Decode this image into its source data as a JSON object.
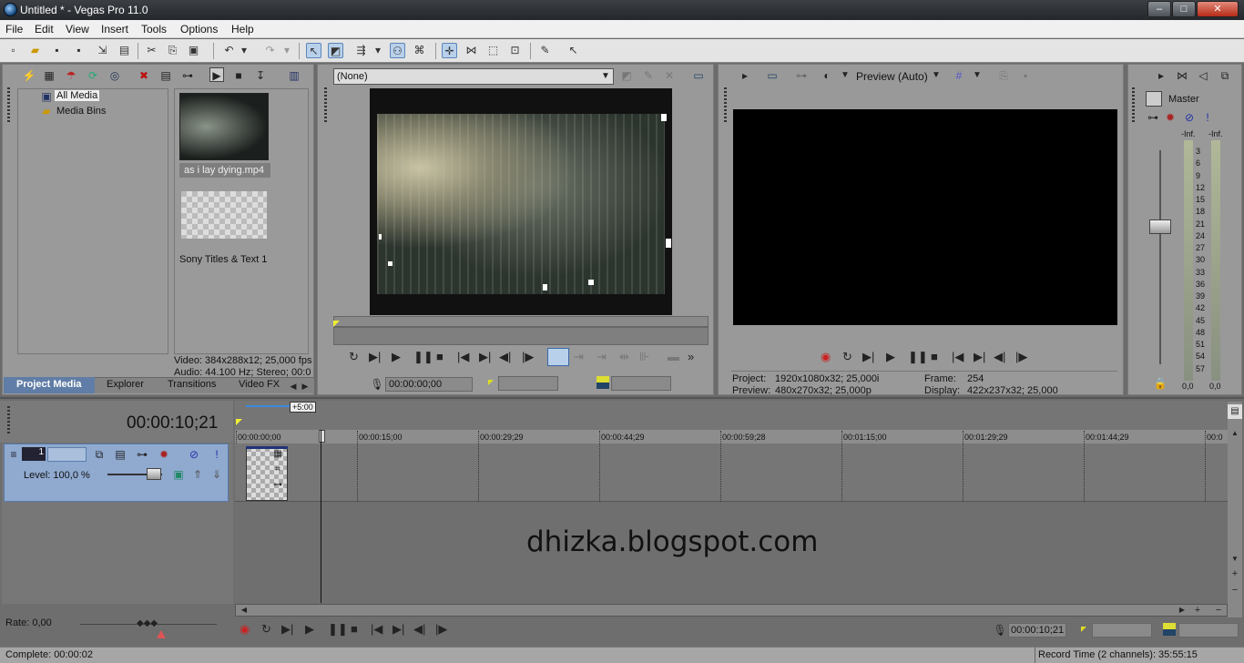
{
  "window": {
    "title": "Untitled * - Vegas Pro 11.0",
    "min": "–",
    "max": "□",
    "close": "✕"
  },
  "menu": [
    "File",
    "Edit",
    "View",
    "Insert",
    "Tools",
    "Options",
    "Help"
  ],
  "media": {
    "tree_items": [
      "All Media",
      "Media Bins"
    ],
    "thumbs": [
      {
        "label": "as i lay dying.mp4"
      },
      {
        "label": "Sony Titles & Text 1"
      }
    ],
    "info_video": "Video: 384x288x12; 25,000 fps",
    "info_audio": "Audio: 44.100 Hz; Stereo; 00:0",
    "tabs": [
      "Project Media",
      "Explorer",
      "Transitions",
      "Video FX"
    ]
  },
  "trimmer": {
    "dropdown": "(None)",
    "timecode": "00:00:00;00"
  },
  "preview": {
    "mode": "Preview (Auto)",
    "project_label": "Project:",
    "project_val": "1920x1080x32; 25,000i",
    "preview_label": "Preview:",
    "preview_val": "480x270x32; 25,000p",
    "frame_label": "Frame:",
    "frame_val": "254",
    "display_label": "Display:",
    "display_val": "422x237x32; 25,000"
  },
  "mixer": {
    "master": "Master",
    "inf_left": "-Inf.",
    "inf_right": "-Inf.",
    "scale": [
      "3",
      "6",
      "9",
      "12",
      "15",
      "18",
      "21",
      "24",
      "27",
      "30",
      "33",
      "36",
      "39",
      "42",
      "45",
      "48",
      "51",
      "54",
      "57"
    ],
    "bottom_left": "0,0",
    "bottom_right": "0,0"
  },
  "timeline": {
    "time": "00:00:10;21",
    "marker": "+5:00",
    "ruler": [
      "00:00:00;00",
      "00:00:15;00",
      "00:00:29;29",
      "00:00:44;29",
      "00:00:59;28",
      "00:01:15;00",
      "00:01:29;29",
      "00:01:44;29",
      "00:0"
    ],
    "track_num": "1",
    "level": "Level: 100,0 %",
    "watermark": "dhizka.blogspot.com",
    "rate": "Rate: 0,00",
    "bottom_time": "00:00:10;21"
  },
  "status": {
    "left": "Complete: 00:00:02",
    "right": "Record Time (2 channels): 35:55:15"
  }
}
